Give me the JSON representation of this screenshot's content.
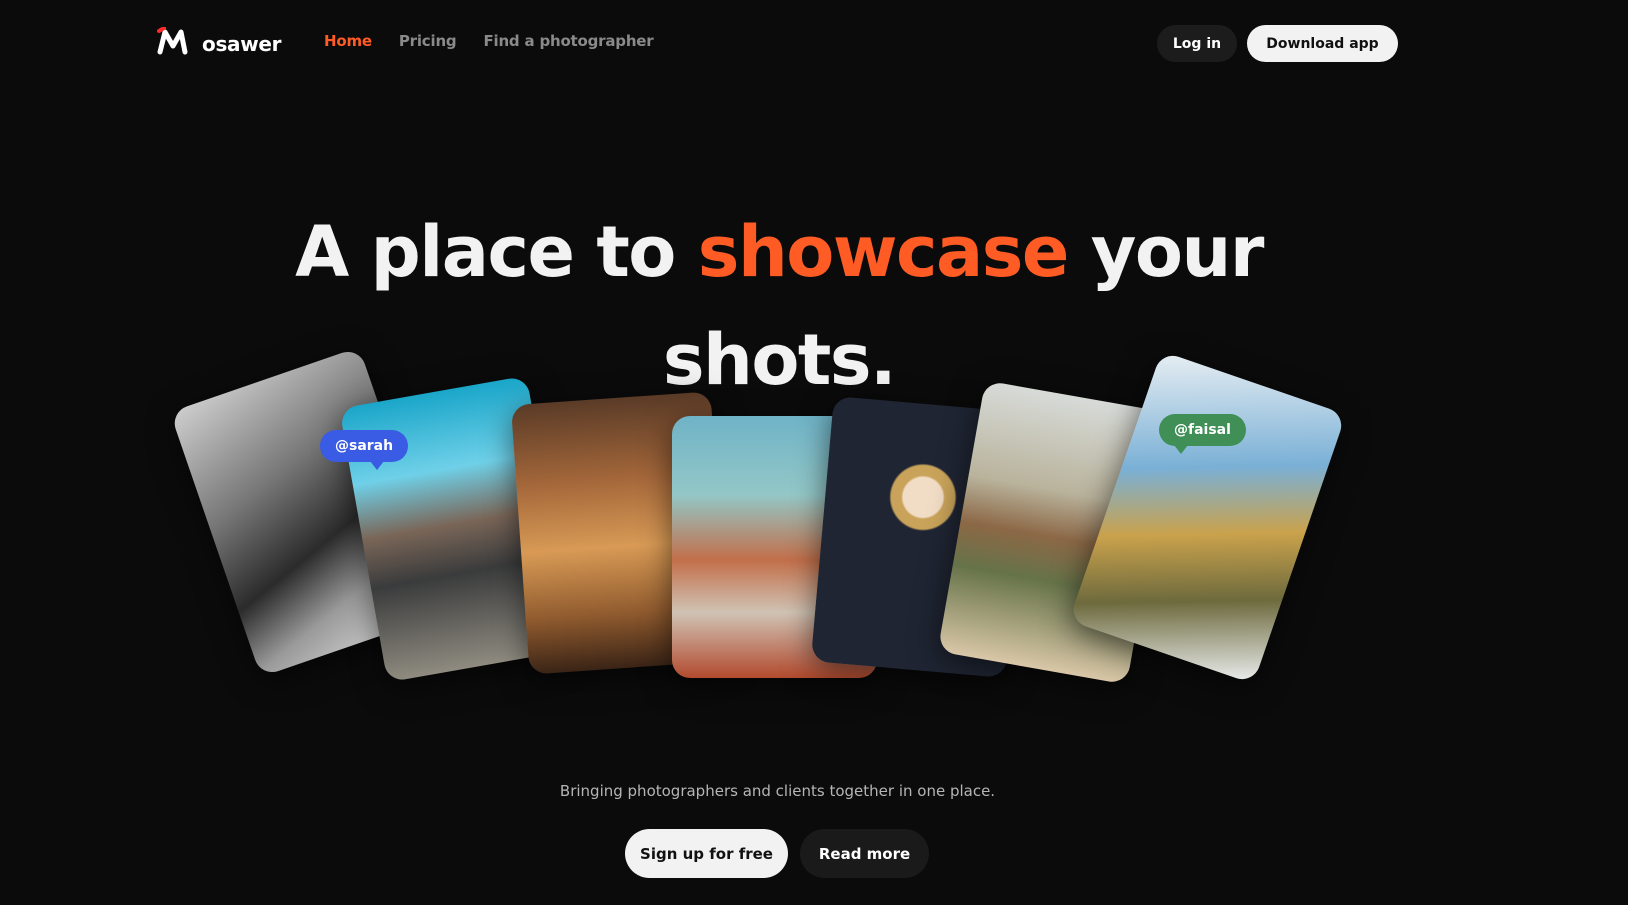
{
  "brand": {
    "logo_text": "osawer",
    "accent_color": "#ff5b24"
  },
  "nav": {
    "links": [
      {
        "label": "Home",
        "active": true
      },
      {
        "label": "Pricing",
        "active": false
      },
      {
        "label": "Find a photographer",
        "active": false
      }
    ],
    "login_label": "Log in",
    "download_label": "Download app"
  },
  "hero": {
    "title_part1": "A place to ",
    "title_accent": "showcase",
    "title_part2": " your",
    "title_line2": "shots.",
    "tags": [
      {
        "handle": "@sarah",
        "color": "#3a5be4"
      },
      {
        "handle": "@faisal",
        "color": "#3f8f57"
      }
    ],
    "subtitle": "Bringing photographers and clients together in one place.",
    "signup_label": "Sign up for free",
    "readmore_label": "Read more"
  }
}
